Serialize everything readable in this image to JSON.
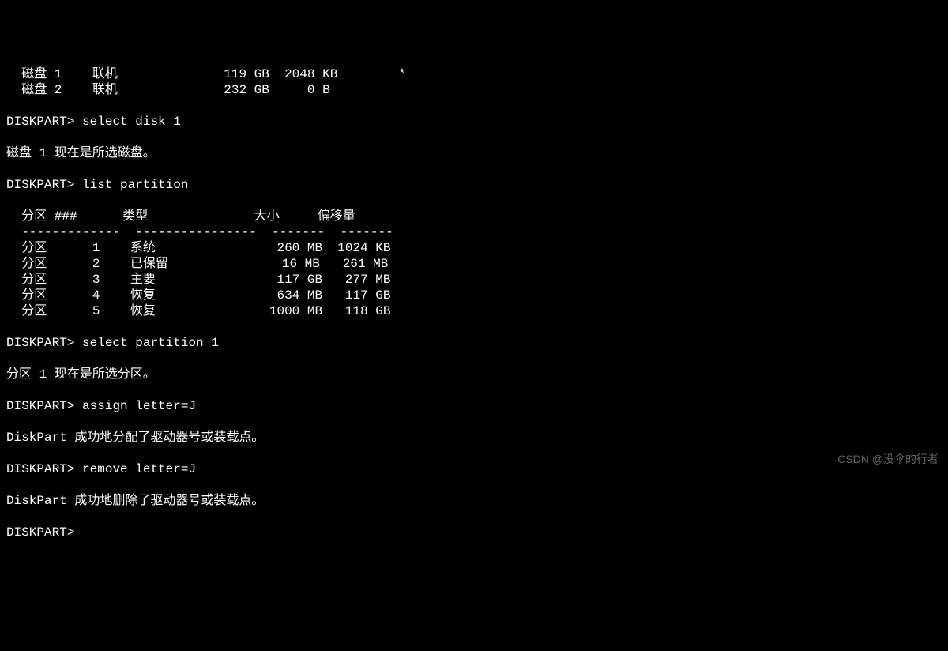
{
  "disks": [
    {
      "name": "磁盘 1",
      "status": "联机",
      "size": "119 GB",
      "free": "2048 KB",
      "dyn": "",
      "gpt": "*"
    },
    {
      "name": "磁盘 2",
      "status": "联机",
      "size": "232 GB",
      "free": "   0 B",
      "dyn": "",
      "gpt": ""
    }
  ],
  "prompt": "DISKPART>",
  "commands": {
    "select_disk": "select disk 1",
    "list_partition": "list partition",
    "select_partition": "select partition 1",
    "assign": "assign letter=J",
    "remove": "remove letter=J"
  },
  "messages": {
    "disk_selected": "磁盘 1 现在是所选磁盘。",
    "partition_selected": "分区 1 现在是所选分区。",
    "assign_success": "DiskPart 成功地分配了驱动器号或装载点。",
    "remove_success": "DiskPart 成功地删除了驱动器号或装载点。"
  },
  "partition_header": {
    "col1": "分区 ###",
    "col2": "类型",
    "col3": "大小",
    "col4": "偏移量"
  },
  "partition_divider": {
    "col1": "-------------",
    "col2": "----------------",
    "col3": "-------",
    "col4": "-------"
  },
  "partitions": [
    {
      "name": "分区      1",
      "type": "系统",
      "size": " 260 MB",
      "offset": "1024 KB"
    },
    {
      "name": "分区      2",
      "type": "已保留",
      "size": "  16 MB",
      "offset": " 261 MB"
    },
    {
      "name": "分区      3",
      "type": "主要",
      "size": " 117 GB",
      "offset": " 277 MB"
    },
    {
      "name": "分区      4",
      "type": "恢复",
      "size": " 634 MB",
      "offset": " 117 GB"
    },
    {
      "name": "分区      5",
      "type": "恢复",
      "size": "1000 MB",
      "offset": " 118 GB"
    }
  ],
  "watermark": "CSDN @没伞的行者"
}
